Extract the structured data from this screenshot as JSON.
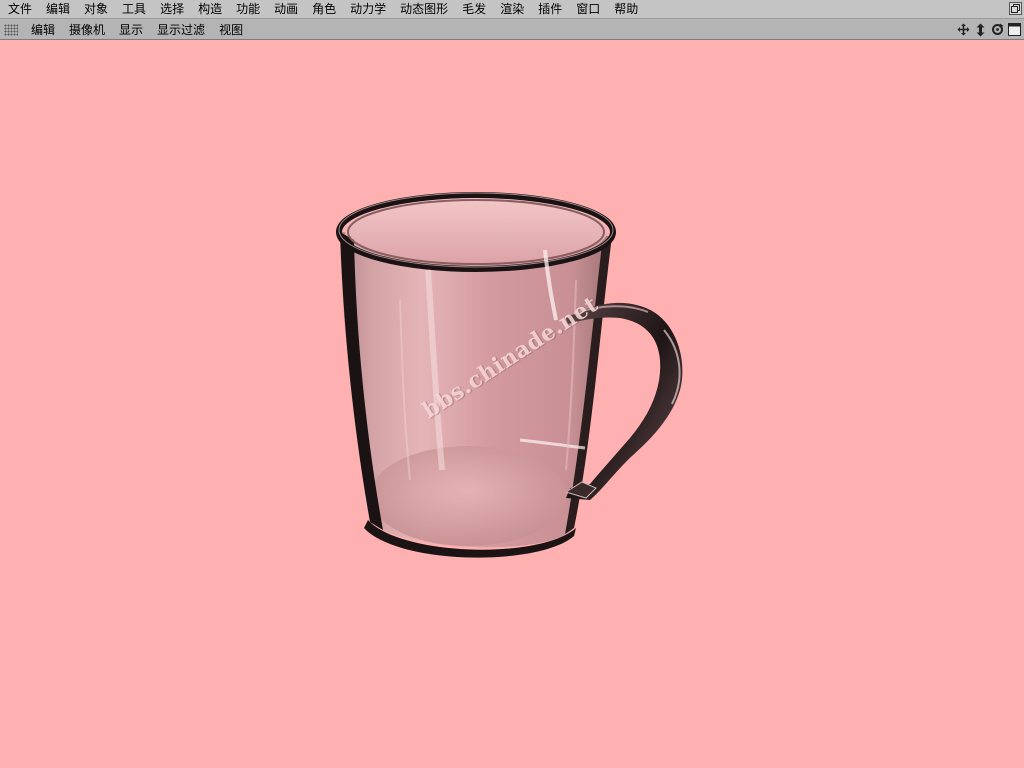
{
  "menubar": {
    "items": [
      "文件",
      "编辑",
      "对象",
      "工具",
      "选择",
      "构造",
      "功能",
      "动画",
      "角色",
      "动力学",
      "动态图形",
      "毛发",
      "渲染",
      "插件",
      "窗口",
      "帮助"
    ]
  },
  "viewbar": {
    "items": [
      "编辑",
      "摄像机",
      "显示",
      "显示过滤",
      "视图"
    ],
    "nav_icons": [
      "move-view-icon",
      "dolly-view-icon",
      "rotate-view-icon",
      "maximize-view-icon"
    ]
  },
  "viewport": {
    "background_color": "#ffb1b2",
    "object": "glass-mug",
    "watermark": "bbs.chinade.net"
  }
}
